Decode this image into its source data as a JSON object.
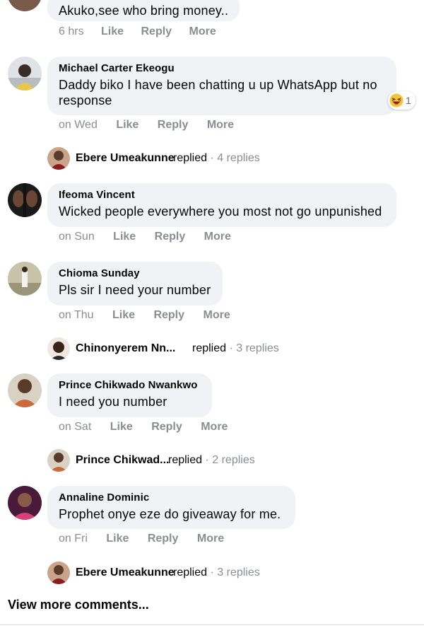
{
  "comments": [
    {
      "text": "Akuko,see who bring money..",
      "actions": {
        "time": "6 hrs",
        "like": "Like",
        "reply": "Reply",
        "more": "More"
      }
    },
    {
      "author": "Michael Carter Ekeogu",
      "text": "Daddy biko I have been chatting u up WhatsApp but no response",
      "reaction": {
        "icon": "laughing-emoji-icon",
        "count": "1"
      },
      "actions": {
        "time": "on Wed",
        "like": "Like",
        "reply": "Reply",
        "more": "More"
      },
      "replies": {
        "name": "Ebere Umeakunne",
        "verb": "replied",
        "count": "4 replies"
      }
    },
    {
      "author": "Ifeoma Vincent",
      "text": "Wicked people everywhere you most not go unpunished",
      "actions": {
        "time": "on Sun",
        "like": "Like",
        "reply": "Reply",
        "more": "More"
      }
    },
    {
      "author": "Chioma Sunday",
      "text": "Pls sir I need your number",
      "actions": {
        "time": "on Thu",
        "like": "Like",
        "reply": "Reply",
        "more": "More"
      },
      "replies": {
        "name": "Chinonyerem Nn...",
        "verb": "replied",
        "count": "3 replies"
      }
    },
    {
      "author": "Prince Chikwado Nwankwo",
      "text": "I need you number",
      "actions": {
        "time": "on Sat",
        "like": "Like",
        "reply": "Reply",
        "more": "More"
      },
      "replies": {
        "name": "Prince Chikwad...",
        "verb": "replied",
        "count": "2 replies"
      }
    },
    {
      "author": "Annaline Dominic",
      "text": "Prophet onye eze do giveaway for me.",
      "actions": {
        "time": "on Fri",
        "like": "Like",
        "reply": "Reply",
        "more": "More"
      },
      "replies": {
        "name": "Ebere Umeakunne",
        "verb": "replied",
        "count": "3 replies"
      }
    }
  ],
  "footer": {
    "view_more": "View more comments..."
  },
  "colors": {
    "bubble": "#f0f2f5",
    "muted": "#8a8d91",
    "text": "#050505",
    "divider": "#dadde1"
  }
}
